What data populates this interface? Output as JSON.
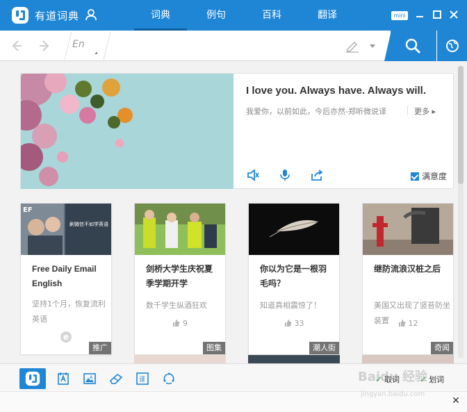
{
  "app": {
    "title": "有道词典",
    "mini_label": "mini"
  },
  "tabs": [
    {
      "label": "词典",
      "active": true
    },
    {
      "label": "例句",
      "active": false
    },
    {
      "label": "百科",
      "active": false
    },
    {
      "label": "翻译",
      "active": false
    }
  ],
  "search": {
    "lang": "En",
    "value": "",
    "placeholder": ""
  },
  "hero": {
    "quote": "I love you. Always have. Always will.",
    "translation": "我爱你，以前如此，今后亦然-郑听微说译",
    "more_label": "更多",
    "satisfaction_label": "满意度",
    "satisfaction_checked": true
  },
  "cards": [
    {
      "tag": "推广",
      "title": "Free Daily Email English",
      "desc": "坚持1个月，恢复流利英语",
      "likes": "",
      "img_caption": "刷微信不如学英语"
    },
    {
      "tag": "图集",
      "title": "剑桥大学生庆祝夏季学期开学",
      "desc": "数千学生纵酒狂欢",
      "likes": "9"
    },
    {
      "tag": "潮人街",
      "title": "你以为它是一根羽毛吗？",
      "desc": "知道真相震惊了！",
      "likes": "33"
    },
    {
      "tag": "奇闻",
      "title": "继防流浪汉桩之后",
      "desc": "美国又出现了竖苔防坐装置",
      "likes": "12"
    }
  ],
  "toolbar": {
    "checks": [
      {
        "label": "取词",
        "checked": true
      },
      {
        "label": "划词",
        "checked": true
      }
    ]
  },
  "watermark": {
    "text": "Baidu 经验",
    "sub": "jingyan.baidu.com"
  },
  "colors": {
    "accent": "#1f86d6",
    "dark_tab": "#0d5fa0"
  }
}
